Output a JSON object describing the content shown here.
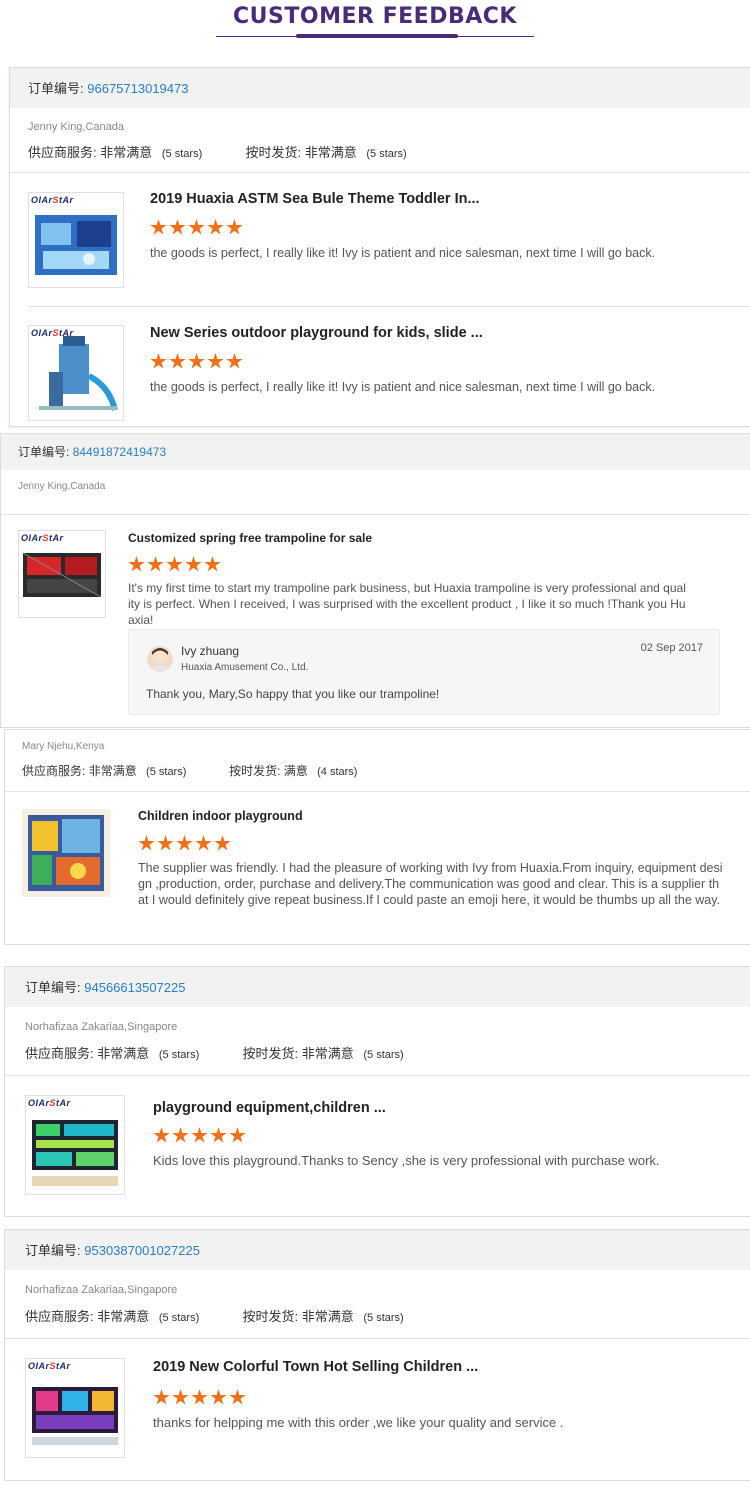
{
  "header": {
    "title": "CUSTOMER FEEDBACK"
  },
  "labels": {
    "order_prefix": "订单编号:",
    "service": "供应商服务:",
    "shipping": "按时发货:"
  },
  "cards": [
    {
      "order_no": "96675713019473",
      "customer": "Jenny King,Canada",
      "service_val": "非常满意",
      "service_stars": "(5 stars)",
      "ship_val": "非常满意",
      "ship_stars": "(5 stars)",
      "products": [
        {
          "title": "2019 Huaxia ASTM Sea Bule Theme Toddler In...",
          "rating": 5,
          "comment": "the goods is perfect, I really like it! Ivy is patient and nice salesman, next time I will go back."
        },
        {
          "title": "New Series outdoor playground for kids, slide ...",
          "rating": 5,
          "comment": "the goods is perfect, I really like it! Ivy is patient and nice salesman, next time I will go back."
        }
      ]
    },
    {
      "order_no": "84491872419473",
      "customer": "Jenny King,Canada",
      "products": [
        {
          "title": "Customized spring free trampoline for sale",
          "rating": 5,
          "comment": "It's my first time to start my trampoline park business, but Huaxia trampoline is very professional and quality is perfect. When I received, I was surprised with the excellent product , I like it so much !Thank you Huaxia!"
        }
      ],
      "reply": {
        "name": "Ivy zhuang",
        "company": "Huaxia Amusement Co., Ltd.",
        "date": "02 Sep 2017",
        "text": "Thank you, Mary,So happy that you like our trampoline!"
      }
    },
    {
      "customer": "Mary Njehu,Kenya",
      "service_val": "非常满意",
      "service_stars": "(5 stars)",
      "ship_val": "满意",
      "ship_stars": "(4 stars)",
      "products": [
        {
          "title": "Children indoor playground",
          "rating": 5,
          "comment": "The supplier was friendly. I had the pleasure of working with Ivy from Huaxia.From inquiry, equipment design ,production, order, purchase and delivery.The communication was good and clear. This is a supplier that I would definitely give repeat business.If I could paste an emoji here, it would be thumbs up all the way."
        }
      ]
    },
    {
      "order_no": "94566613507225",
      "customer": "Norhafizaa Zakariaa,Singapore",
      "service_val": "非常满意",
      "service_stars": "(5 stars)",
      "ship_val": "非常满意",
      "ship_stars": "(5 stars)",
      "products": [
        {
          "title": "playground equipment,children ...",
          "rating": 5,
          "comment": "Kids love this playground.Thanks to Sency ,she is very professional with purchase work."
        }
      ]
    },
    {
      "order_no": "9530387001027225",
      "customer": "Norhafizaa Zakariaa,Singapore",
      "service_val": "非常满意",
      "service_stars": "(5 stars)",
      "ship_val": "非常满意",
      "ship_stars": "(5 stars)",
      "products": [
        {
          "title": "2019 New Colorful Town Hot Selling Children ...",
          "rating": 5,
          "comment": "thanks for helpping me with this order ,we like your quality and service ."
        }
      ]
    }
  ],
  "brand": {
    "text": "OIArStAr",
    "colors": {
      "accent": "#4a2b78",
      "link": "#2a7ec6",
      "star": "#f36f18"
    }
  }
}
